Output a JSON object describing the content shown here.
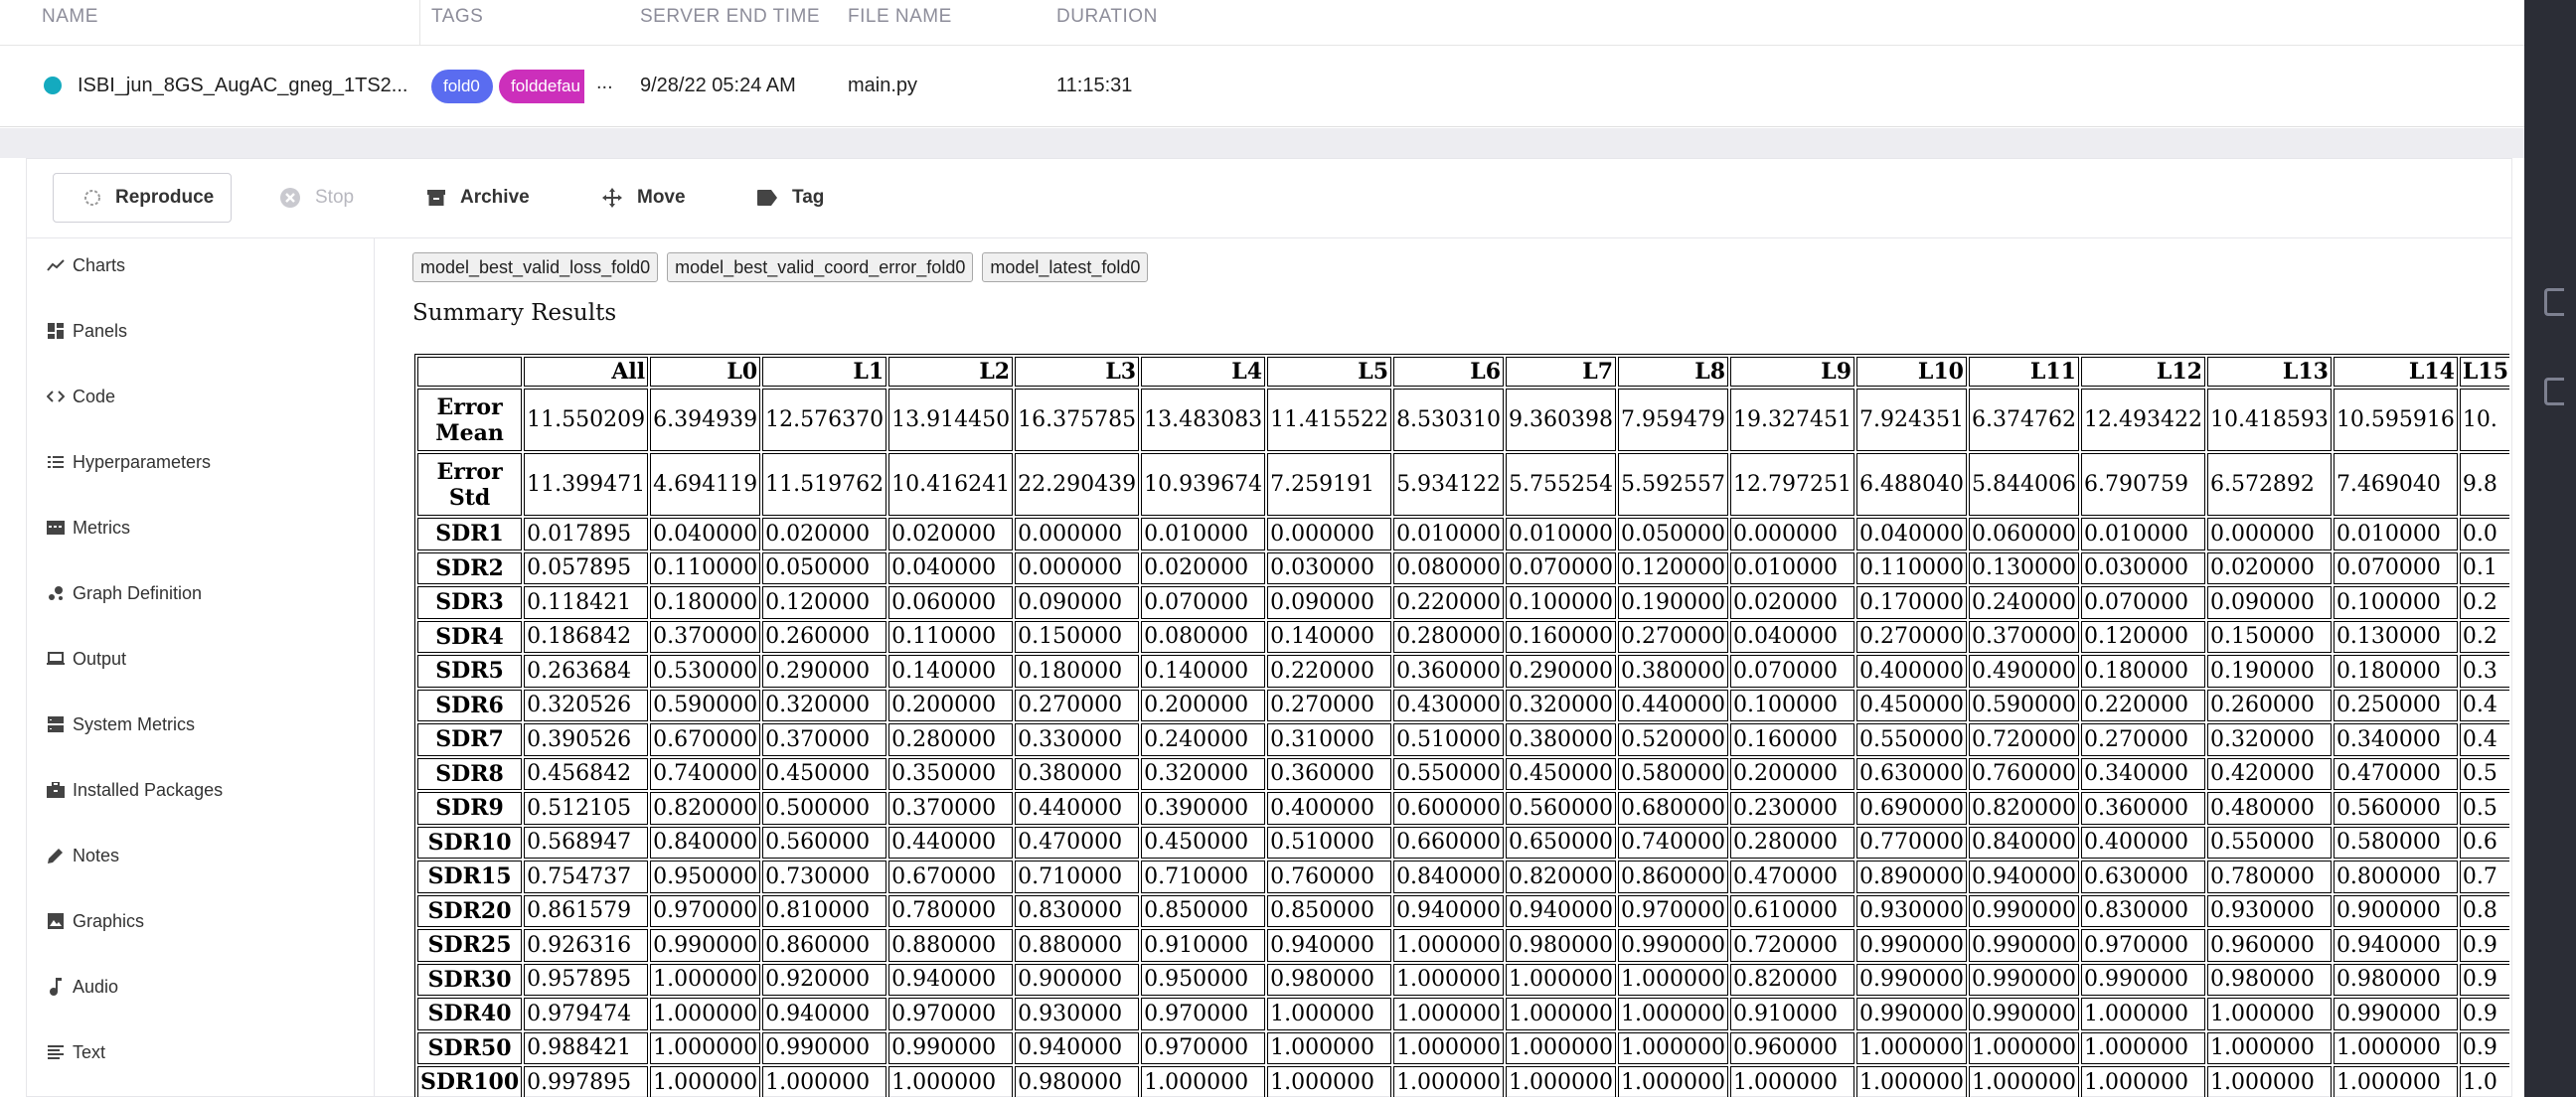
{
  "runs_table": {
    "columns": [
      "NAME",
      "TAGS",
      "SERVER END TIME",
      "FILE NAME",
      "DURATION"
    ],
    "row": {
      "name": "ISBI_jun_8GS_AugAC_gneg_1TS2...",
      "tags": [
        "fold0",
        "folddefau"
      ],
      "more": "...",
      "server_end_time": "9/28/22 05:24 AM",
      "file_name": "main.py",
      "duration": "11:15:31"
    }
  },
  "colors": {
    "status": "#14aabf",
    "tag1": "#5a6cf0",
    "tag2": "#cc2fbb"
  },
  "toolbar": {
    "reproduce": "Reproduce",
    "stop": "Stop",
    "archive": "Archive",
    "move": "Move",
    "tag": "Tag"
  },
  "sidebar": {
    "items": [
      {
        "label": "Charts",
        "icon": "line-chart-icon"
      },
      {
        "label": "Panels",
        "icon": "panels-icon"
      },
      {
        "label": "Code",
        "icon": "code-icon"
      },
      {
        "label": "Hyperparameters",
        "icon": "list-icon"
      },
      {
        "label": "Metrics",
        "icon": "metrics-icon"
      },
      {
        "label": "Graph Definition",
        "icon": "graph-icon"
      },
      {
        "label": "Output",
        "icon": "laptop-icon"
      },
      {
        "label": "System Metrics",
        "icon": "system-icon"
      },
      {
        "label": "Installed Packages",
        "icon": "package-icon"
      },
      {
        "label": "Notes",
        "icon": "pencil-icon"
      },
      {
        "label": "Graphics",
        "icon": "image-icon"
      },
      {
        "label": "Audio",
        "icon": "music-note-icon"
      },
      {
        "label": "Text",
        "icon": "text-icon"
      }
    ]
  },
  "models": [
    "model_best_valid_loss_fold0",
    "model_best_valid_coord_error_fold0",
    "model_latest_fold0"
  ],
  "summary": {
    "title": "Summary Results",
    "columns": [
      "All",
      "L0",
      "L1",
      "L2",
      "L3",
      "L4",
      "L5",
      "L6",
      "L7",
      "L8",
      "L9",
      "L10",
      "L11",
      "L12",
      "L13",
      "L14",
      "L15"
    ],
    "rows": [
      {
        "label": "Error Mean",
        "values": [
          "11.550209",
          "6.394939",
          "12.576370",
          "13.914450",
          "16.375785",
          "13.483083",
          "11.415522",
          "8.530310",
          "9.360398",
          "7.959479",
          "19.327451",
          "7.924351",
          "6.374762",
          "12.493422",
          "10.418593",
          "10.595916",
          "10."
        ]
      },
      {
        "label": "Error Std",
        "values": [
          "11.399471",
          "4.694119",
          "11.519762",
          "10.416241",
          "22.290439",
          "10.939674",
          "7.259191",
          "5.934122",
          "5.755254",
          "5.592557",
          "12.797251",
          "6.488040",
          "5.844006",
          "6.790759",
          "6.572892",
          "7.469040",
          "9.8"
        ]
      },
      {
        "label": "SDR1",
        "values": [
          "0.017895",
          "0.040000",
          "0.020000",
          "0.020000",
          "0.000000",
          "0.010000",
          "0.000000",
          "0.010000",
          "0.010000",
          "0.050000",
          "0.000000",
          "0.040000",
          "0.060000",
          "0.010000",
          "0.000000",
          "0.010000",
          "0.0"
        ]
      },
      {
        "label": "SDR2",
        "values": [
          "0.057895",
          "0.110000",
          "0.050000",
          "0.040000",
          "0.000000",
          "0.020000",
          "0.030000",
          "0.080000",
          "0.070000",
          "0.120000",
          "0.010000",
          "0.110000",
          "0.130000",
          "0.030000",
          "0.020000",
          "0.070000",
          "0.1"
        ]
      },
      {
        "label": "SDR3",
        "values": [
          "0.118421",
          "0.180000",
          "0.120000",
          "0.060000",
          "0.090000",
          "0.070000",
          "0.090000",
          "0.220000",
          "0.100000",
          "0.190000",
          "0.020000",
          "0.170000",
          "0.240000",
          "0.070000",
          "0.090000",
          "0.100000",
          "0.2"
        ]
      },
      {
        "label": "SDR4",
        "values": [
          "0.186842",
          "0.370000",
          "0.260000",
          "0.110000",
          "0.150000",
          "0.080000",
          "0.140000",
          "0.280000",
          "0.160000",
          "0.270000",
          "0.040000",
          "0.270000",
          "0.370000",
          "0.120000",
          "0.150000",
          "0.130000",
          "0.2"
        ]
      },
      {
        "label": "SDR5",
        "values": [
          "0.263684",
          "0.530000",
          "0.290000",
          "0.140000",
          "0.180000",
          "0.140000",
          "0.220000",
          "0.360000",
          "0.290000",
          "0.380000",
          "0.070000",
          "0.400000",
          "0.490000",
          "0.180000",
          "0.190000",
          "0.180000",
          "0.3"
        ]
      },
      {
        "label": "SDR6",
        "values": [
          "0.320526",
          "0.590000",
          "0.320000",
          "0.200000",
          "0.270000",
          "0.200000",
          "0.270000",
          "0.430000",
          "0.320000",
          "0.440000",
          "0.100000",
          "0.450000",
          "0.590000",
          "0.220000",
          "0.260000",
          "0.250000",
          "0.4"
        ]
      },
      {
        "label": "SDR7",
        "values": [
          "0.390526",
          "0.670000",
          "0.370000",
          "0.280000",
          "0.330000",
          "0.240000",
          "0.310000",
          "0.510000",
          "0.380000",
          "0.520000",
          "0.160000",
          "0.550000",
          "0.720000",
          "0.270000",
          "0.320000",
          "0.340000",
          "0.4"
        ]
      },
      {
        "label": "SDR8",
        "values": [
          "0.456842",
          "0.740000",
          "0.450000",
          "0.350000",
          "0.380000",
          "0.320000",
          "0.360000",
          "0.550000",
          "0.450000",
          "0.580000",
          "0.200000",
          "0.630000",
          "0.760000",
          "0.340000",
          "0.420000",
          "0.470000",
          "0.5"
        ]
      },
      {
        "label": "SDR9",
        "values": [
          "0.512105",
          "0.820000",
          "0.500000",
          "0.370000",
          "0.440000",
          "0.390000",
          "0.400000",
          "0.600000",
          "0.560000",
          "0.680000",
          "0.230000",
          "0.690000",
          "0.820000",
          "0.360000",
          "0.480000",
          "0.560000",
          "0.5"
        ]
      },
      {
        "label": "SDR10",
        "values": [
          "0.568947",
          "0.840000",
          "0.560000",
          "0.440000",
          "0.470000",
          "0.450000",
          "0.510000",
          "0.660000",
          "0.650000",
          "0.740000",
          "0.280000",
          "0.770000",
          "0.840000",
          "0.400000",
          "0.550000",
          "0.580000",
          "0.6"
        ]
      },
      {
        "label": "SDR15",
        "values": [
          "0.754737",
          "0.950000",
          "0.730000",
          "0.670000",
          "0.710000",
          "0.710000",
          "0.760000",
          "0.840000",
          "0.820000",
          "0.860000",
          "0.470000",
          "0.890000",
          "0.940000",
          "0.630000",
          "0.780000",
          "0.800000",
          "0.7"
        ]
      },
      {
        "label": "SDR20",
        "values": [
          "0.861579",
          "0.970000",
          "0.810000",
          "0.780000",
          "0.830000",
          "0.850000",
          "0.850000",
          "0.940000",
          "0.940000",
          "0.970000",
          "0.610000",
          "0.930000",
          "0.990000",
          "0.830000",
          "0.930000",
          "0.900000",
          "0.8"
        ]
      },
      {
        "label": "SDR25",
        "values": [
          "0.926316",
          "0.990000",
          "0.860000",
          "0.880000",
          "0.880000",
          "0.910000",
          "0.940000",
          "1.000000",
          "0.980000",
          "0.990000",
          "0.720000",
          "0.990000",
          "0.990000",
          "0.970000",
          "0.960000",
          "0.940000",
          "0.9"
        ]
      },
      {
        "label": "SDR30",
        "values": [
          "0.957895",
          "1.000000",
          "0.920000",
          "0.940000",
          "0.900000",
          "0.950000",
          "0.980000",
          "1.000000",
          "1.000000",
          "1.000000",
          "0.820000",
          "0.990000",
          "0.990000",
          "0.990000",
          "0.980000",
          "0.980000",
          "0.9"
        ]
      },
      {
        "label": "SDR40",
        "values": [
          "0.979474",
          "1.000000",
          "0.940000",
          "0.970000",
          "0.930000",
          "0.970000",
          "1.000000",
          "1.000000",
          "1.000000",
          "1.000000",
          "0.910000",
          "0.990000",
          "0.990000",
          "1.000000",
          "1.000000",
          "0.990000",
          "0.9"
        ]
      },
      {
        "label": "SDR50",
        "values": [
          "0.988421",
          "1.000000",
          "0.990000",
          "0.990000",
          "0.940000",
          "0.970000",
          "1.000000",
          "1.000000",
          "1.000000",
          "1.000000",
          "0.960000",
          "1.000000",
          "1.000000",
          "1.000000",
          "1.000000",
          "1.000000",
          "0.9"
        ]
      },
      {
        "label": "SDR100",
        "values": [
          "0.997895",
          "1.000000",
          "1.000000",
          "1.000000",
          "0.980000",
          "1.000000",
          "1.000000",
          "1.000000",
          "1.000000",
          "1.000000",
          "1.000000",
          "1.000000",
          "1.000000",
          "1.000000",
          "1.000000",
          "1.000000",
          "1.0"
        ]
      }
    ]
  }
}
